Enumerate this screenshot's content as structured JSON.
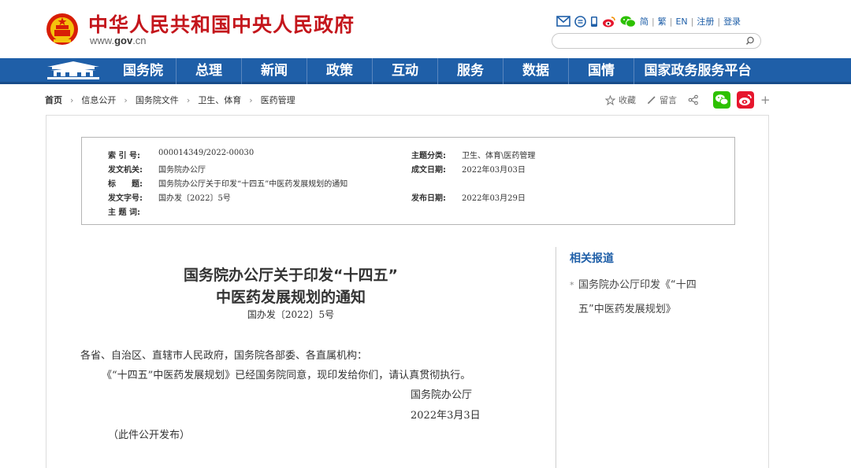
{
  "header": {
    "site_title": "中华人民共和国中央人民政府",
    "site_url_prefix": "www.",
    "site_url_bold": "gov",
    "site_url_suffix": ".cn",
    "links": {
      "simplified": "简",
      "traditional": "繁",
      "english": "EN",
      "register": "注册",
      "login": "登录"
    },
    "search_placeholder": ""
  },
  "nav": {
    "items": [
      "国务院",
      "总理",
      "新闻",
      "政策",
      "互动",
      "服务",
      "数据",
      "国情",
      "国家政务服务平台"
    ]
  },
  "breadcrumb": {
    "items": [
      "首页",
      "信息公开",
      "国务院文件",
      "卫生、体育",
      "医药管理"
    ]
  },
  "share": {
    "favorite": "收藏",
    "comment": "留言",
    "plus": "+"
  },
  "meta": {
    "index_no_label": "索 引 号:",
    "index_no": "000014349/2022-00030",
    "category_label": "主题分类:",
    "category": "卫生、体育\\医药管理",
    "issuer_label": "发文机关:",
    "issuer": "国务院办公厅",
    "written_date_label": "成文日期:",
    "written_date": "2022年03月03日",
    "title_label": "标　　题:",
    "title": "国务院办公厅关于印发“十四五”中医药发展规划的通知",
    "doc_no_label": "发文字号:",
    "doc_no": "国办发〔2022〕5号",
    "publish_date_label": "发布日期:",
    "publish_date": "2022年03月29日",
    "keywords_label": "主 题 词:"
  },
  "article": {
    "title_line1": "国务院办公厅关于印发“十四五”",
    "title_line2": "中医药发展规划的通知",
    "doc_no": "国办发〔2022〕5号",
    "salutation": "各省、自治区、直辖市人民政府，国务院各部委、各直属机构：",
    "body": "《“十四五”中医药发展规划》已经国务院同意，现印发给你们，请认真贯彻执行。",
    "signature": "国务院办公厅",
    "date": "2022年3月3日",
    "note": "（此件公开发布）"
  },
  "related": {
    "title": "相关报道",
    "bullet": "*",
    "item_line1": "国务院办公厅印发《“十四",
    "item_line2": "五”中医药发展规划》"
  },
  "colors": {
    "brand_red": "#c4161c",
    "nav_blue": "#1f5fa8",
    "wechat_green": "#2dc100",
    "weibo_red": "#e6162d"
  }
}
